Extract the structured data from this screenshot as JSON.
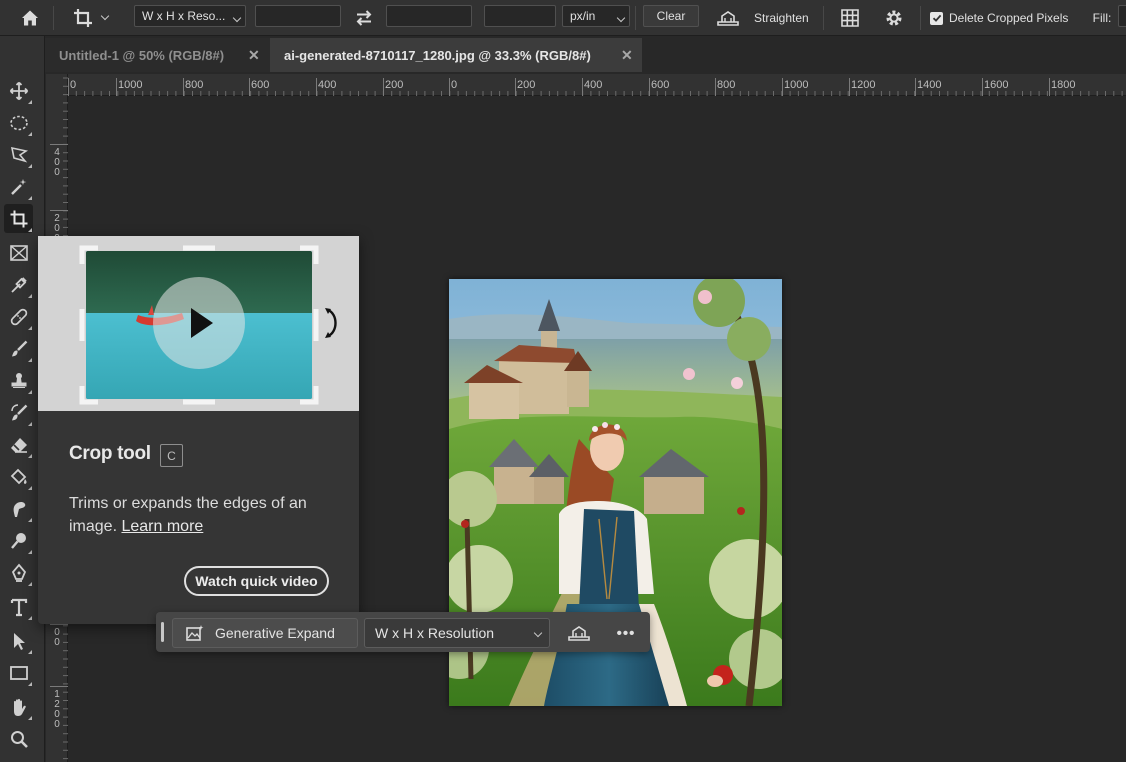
{
  "options_bar": {
    "ratio_select": "W x H x Reso...",
    "width_value": "",
    "height_value": "",
    "resolution_value": "",
    "unit_select": "px/in",
    "clear_label": "Clear",
    "straighten_label": "Straighten",
    "delete_cropped_label": "Delete Cropped Pixels",
    "delete_cropped_checked": true,
    "fill_label": "Fill:"
  },
  "tabs": [
    {
      "label": "Untitled-1 @ 50% (RGB/8#)",
      "active": false
    },
    {
      "label": "ai-generated-8710117_1280.jpg @ 33.3% (RGB/8#)",
      "active": true
    }
  ],
  "ruler": {
    "horizontal": [
      "0",
      "1000",
      "800",
      "600",
      "400",
      "200",
      "0",
      "200",
      "400",
      "600",
      "800",
      "1000",
      "1200",
      "1400",
      "1600",
      "1800"
    ],
    "vertical": [
      "4\n0\n0",
      "2\n0\n0",
      "0\n0",
      "1\n2\n0\n0"
    ]
  },
  "tooltip": {
    "title": "Crop tool",
    "shortcut": "C",
    "description": "Trims or expands the edges of an image.",
    "learn_more": "Learn more",
    "watch_video": "Watch quick video"
  },
  "context_bar": {
    "generative_expand": "Generative Expand",
    "ratio_select": "W x H x Resolution",
    "more": "•••"
  },
  "icons": [
    "home-icon",
    "crop-icon",
    "swap-icon",
    "straighten-icon",
    "grid-overlay-icon",
    "gear-icon",
    "checkbox-icon"
  ],
  "tools": [
    "move-tool",
    "marquee-tool",
    "lasso-tool",
    "magic-wand-tool",
    "crop-tool",
    "frame-tool",
    "eyedropper-tool",
    "healing-brush-tool",
    "brush-tool",
    "clone-stamp-tool",
    "history-brush-tool",
    "eraser-tool",
    "paint-bucket-tool",
    "smudge-tool",
    "dodge-tool",
    "pen-tool",
    "type-tool",
    "path-selection-tool",
    "rectangle-tool",
    "hand-tool",
    "zoom-tool"
  ],
  "colors": {
    "app_bg": "#282828",
    "panel": "#323232",
    "tooltip_bg": "#353535",
    "video_bg": "#d3d3d3",
    "lake": "#3fb2c0"
  }
}
